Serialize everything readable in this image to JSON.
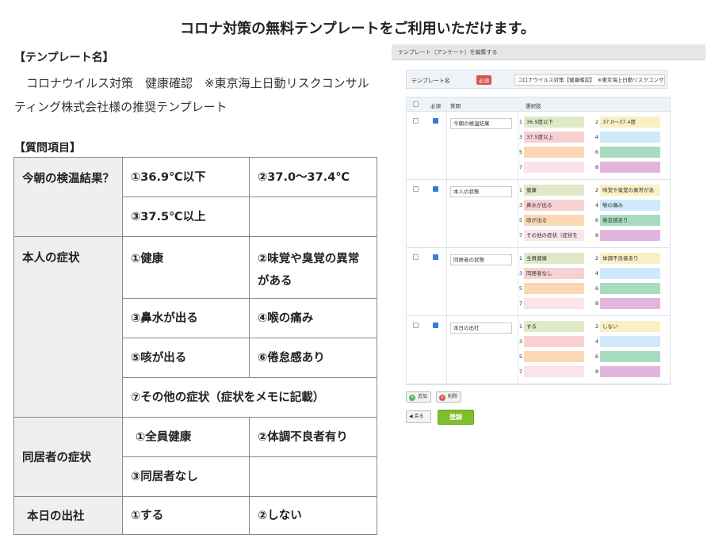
{
  "headline": "コロナ対策の無料テンプレートをご利用いただけます。",
  "template_name_label": "【テンプレート名】",
  "template_desc": "　コロナウイルス対策　健康確認　※東京海上日動リスクコンサルティング株式会社様の推奨テンプレート",
  "question_items_label": "【質問項目】",
  "questions": [
    {
      "title": "今朝の検温結果？",
      "options": [
        "①36.9℃以下",
        "②37.0～37.4℃",
        "③37.5℃以上",
        ""
      ]
    },
    {
      "title": "本人の症状",
      "options": [
        "①健康",
        "②味覚や臭覚の異常がある",
        "③鼻水が出る",
        "④喉の痛み",
        "⑤咳が出る",
        "⑥倦怠感あり",
        "⑦その他の症状（症状をメモに記載）"
      ]
    },
    {
      "title": "同居者の症状",
      "options": [
        "①全員健康",
        "②体調不良者有り",
        "③同居者なし",
        ""
      ]
    },
    {
      "title": "本日の出社",
      "options": [
        "①する",
        "②しない"
      ]
    }
  ],
  "screenshot": {
    "title": "テンプレート（アンケート）を編集する",
    "name_label": "テンプレート名",
    "required_badge": "必須",
    "name_value": "コロナウイルス対策【健康確認】　※東京海上日動リスクコンサル",
    "col_required": "必須",
    "col_question": "質問",
    "col_choices": "選択肢",
    "blocks": [
      {
        "question": "今朝の検温結果",
        "choices": [
          "36.9度以下",
          "37.0〜37.4度",
          "37.5度以上",
          "",
          "",
          "",
          "",
          ""
        ]
      },
      {
        "question": "本人の状態",
        "choices": [
          "健康",
          "味覚や臭覚の異常があ",
          "鼻水が出る",
          "喉の痛み",
          "咳が出る",
          "倦怠感あり",
          "その他の症状（症状を",
          ""
        ]
      },
      {
        "question": "同居者の状態",
        "choices": [
          "全員健康",
          "体調不良者あり",
          "同居者なし",
          "",
          "",
          "",
          "",
          ""
        ]
      },
      {
        "question": "本日の出社",
        "choices": [
          "する",
          "しない",
          "",
          "",
          "",
          "",
          "",
          ""
        ]
      }
    ],
    "choice_numbers": [
      "1",
      "2",
      "3",
      "4",
      "5",
      "6",
      "7",
      "8"
    ],
    "add_label": "追加",
    "delete_label": "削除",
    "back_label": "戻る",
    "save_label": "登録",
    "colors": {
      "choice": [
        "#dfe9c8",
        "#fbefc4",
        "#f7d0d2",
        "#cfe9fa",
        "#fbd8b3",
        "#a8dcc0",
        "#fbe3ea",
        "#e2b6dc"
      ],
      "save": "#7fbf2e",
      "required": "#d9534f"
    }
  }
}
